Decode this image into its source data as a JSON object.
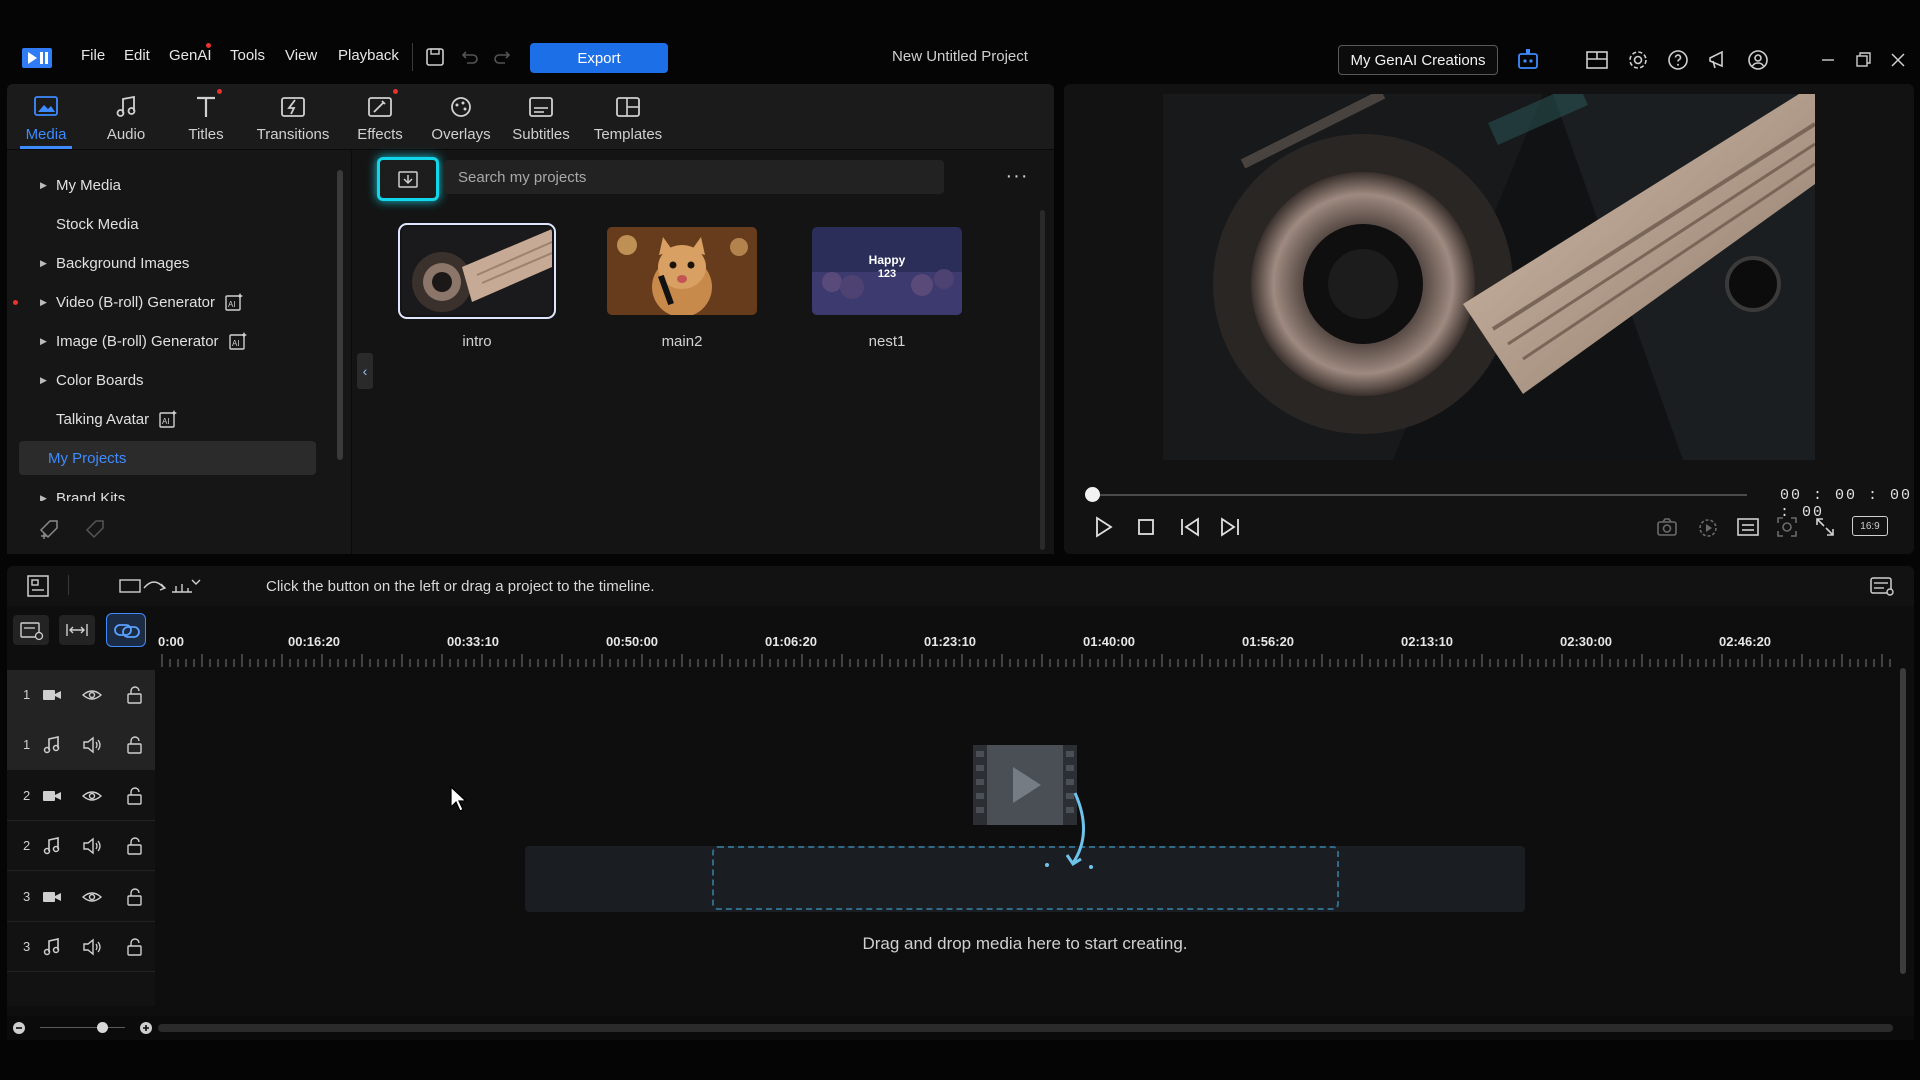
{
  "app": {
    "menu": [
      "File",
      "Edit",
      "GenAI",
      "Tools",
      "View",
      "Playback"
    ],
    "export_label": "Export",
    "project_title": "New Untitled Project",
    "genai_creations_label": "My GenAI Creations"
  },
  "room_tabs": [
    "Media",
    "Audio",
    "Titles",
    "Transitions",
    "Effects",
    "Overlays",
    "Subtitles",
    "Templates"
  ],
  "sidebar": {
    "items": [
      {
        "label": "My Media"
      },
      {
        "label": "Stock Media"
      },
      {
        "label": "Background Images"
      },
      {
        "label": "Video (B-roll) Generator"
      },
      {
        "label": "Image (B-roll) Generator"
      },
      {
        "label": "Color Boards"
      },
      {
        "label": "Talking Avatar"
      },
      {
        "label": "My Projects"
      },
      {
        "label": "Brand Kits"
      }
    ]
  },
  "library": {
    "search_placeholder": "Search my projects",
    "more_label": "···",
    "projects": [
      {
        "name": "intro"
      },
      {
        "name": "main2"
      },
      {
        "name": "nest1"
      }
    ],
    "nest_thumb_text": [
      "Happy",
      "123"
    ]
  },
  "preview": {
    "timecode": "00 : 00 : 00 : 00",
    "aspect_label": "16:9"
  },
  "timeline": {
    "hint": "Click the button on the left or drag a project to the timeline.",
    "ruler": [
      "0:00",
      "00:16:20",
      "00:33:10",
      "00:50:00",
      "01:06:20",
      "01:23:10",
      "01:40:00",
      "01:56:20",
      "02:13:10",
      "02:30:00",
      "02:46:20"
    ],
    "tracks": [
      {
        "num": "1",
        "kind": "video"
      },
      {
        "num": "1",
        "kind": "audio"
      },
      {
        "num": "2",
        "kind": "video"
      },
      {
        "num": "2",
        "kind": "audio"
      },
      {
        "num": "3",
        "kind": "video"
      },
      {
        "num": "3",
        "kind": "audio"
      }
    ],
    "drop_text": "Drag and drop media here to start creating."
  },
  "colors": {
    "accent": "#1d6fe8",
    "active_tab": "#3d8bff",
    "import_highlight": "#12d7ea",
    "notification_dot": "#e8332f"
  }
}
